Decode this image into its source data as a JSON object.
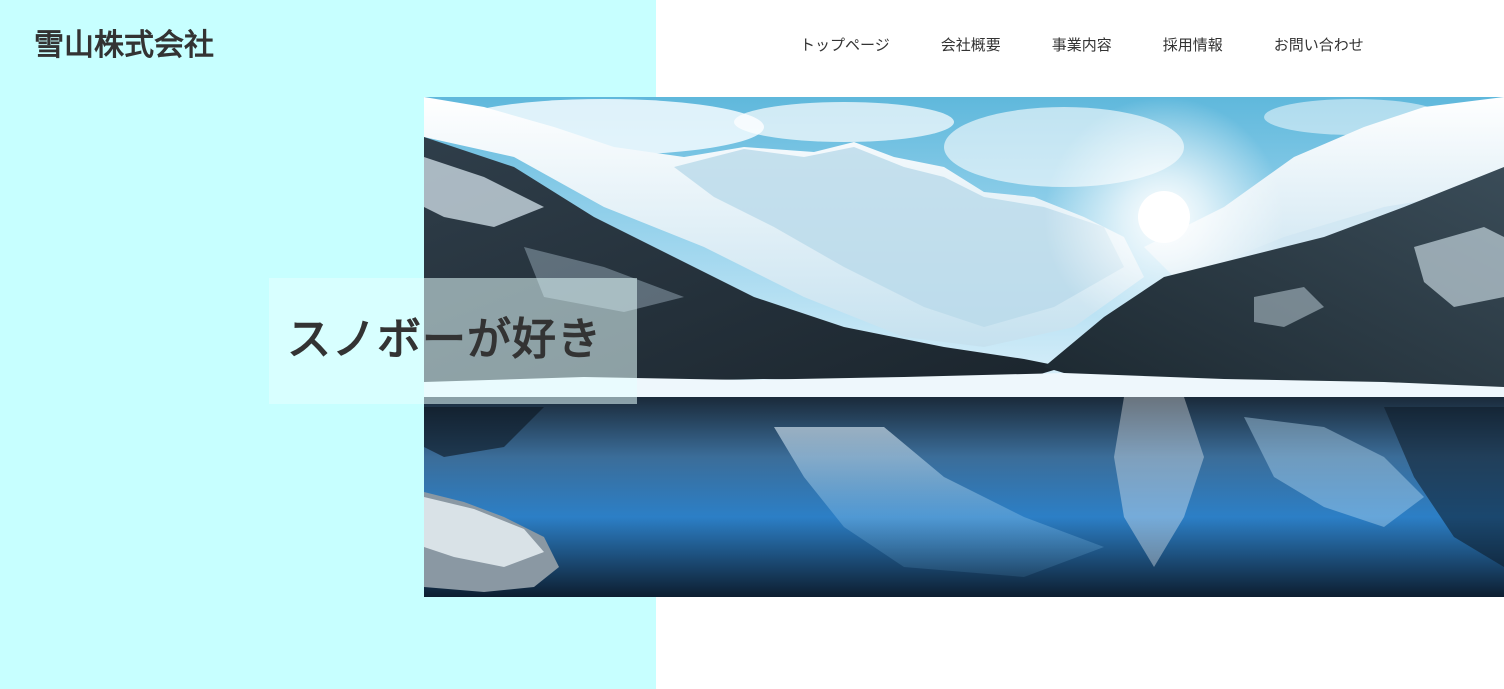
{
  "header": {
    "site_title": "雪山株式会社"
  },
  "nav": {
    "items": [
      {
        "label": "トップページ"
      },
      {
        "label": "会社概要"
      },
      {
        "label": "事業内容"
      },
      {
        "label": "採用情報"
      },
      {
        "label": "お問い合わせ"
      }
    ]
  },
  "hero": {
    "catch_copy": "スノボーが好き",
    "image_subject": "snowy-mountain-lake-photo"
  },
  "colors": {
    "left_panel_bg": "#c7ffff",
    "page_bg": "#ffffff",
    "text": "#333333"
  }
}
